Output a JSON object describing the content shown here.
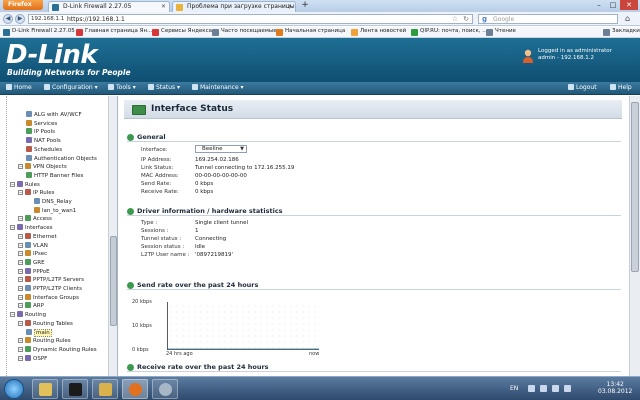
{
  "browser": {
    "app_label": "Firefox",
    "tabs": [
      {
        "title": "D-Link Firewall 2.27.05",
        "active": true
      },
      {
        "title": "Проблема при загрузке страницы",
        "active": false
      }
    ],
    "url_site": "192.168.1.1",
    "url": "https://192.168.1.1",
    "search_placeholder": "Google",
    "bookmarks": [
      "D-Link Firewall 2.27.05",
      "Главная страница Ян...",
      "Сервисы Яндекса",
      "Часто посещаемые",
      "Начальная страница",
      "Лента новостей",
      "QIP.RU: почта, поиск, ...",
      "Чтение",
      "Закладки"
    ]
  },
  "header": {
    "logo": "D-Link",
    "tagline": "Building Networks for People",
    "login_line1": "Logged in as administrator",
    "login_line2": "admin - 192.168.1.2"
  },
  "menu": {
    "home": "Home",
    "configuration": "Configuration",
    "tools": "Tools",
    "status": "Status",
    "maintenance": "Maintenance",
    "logout": "Logout",
    "help": "Help"
  },
  "tree": [
    {
      "label": "ALG with AV/WCF",
      "indent": 3
    },
    {
      "label": "Services",
      "indent": 3
    },
    {
      "label": "IP Pools",
      "indent": 3
    },
    {
      "label": "NAT Pools",
      "indent": 3
    },
    {
      "label": "Schedules",
      "indent": 3
    },
    {
      "label": "Authentication Objects",
      "indent": 3
    },
    {
      "label": "VPN Objects",
      "indent": 2
    },
    {
      "label": "HTTP Banner Files",
      "indent": 3
    },
    {
      "label": "Rules",
      "indent": 1
    },
    {
      "label": "IP Rules",
      "indent": 2
    },
    {
      "label": "DNS_Relay",
      "indent": 4
    },
    {
      "label": "lan_to_wan1",
      "indent": 4
    },
    {
      "label": "Access",
      "indent": 2
    },
    {
      "label": "Interfaces",
      "indent": 1
    },
    {
      "label": "Ethernet",
      "indent": 2
    },
    {
      "label": "VLAN",
      "indent": 2
    },
    {
      "label": "IPsec",
      "indent": 2
    },
    {
      "label": "GRE",
      "indent": 2
    },
    {
      "label": "PPPoE",
      "indent": 2
    },
    {
      "label": "PPTP/L2TP Servers",
      "indent": 2
    },
    {
      "label": "PPTP/L2TP Clients",
      "indent": 2
    },
    {
      "label": "Interface Groups",
      "indent": 2
    },
    {
      "label": "ARP",
      "indent": 2
    },
    {
      "label": "Routing",
      "indent": 1
    },
    {
      "label": "Routing Tables",
      "indent": 2
    },
    {
      "label": "main",
      "indent": 3
    },
    {
      "label": "Routing Rules",
      "indent": 2
    },
    {
      "label": "Dynamic Routing Rules",
      "indent": 2
    },
    {
      "label": "OSPF",
      "indent": 2
    }
  ],
  "page": {
    "title": "Interface Status",
    "general": {
      "heading": "General",
      "interface_label": "Interface:",
      "interface_value": "Beeline",
      "rows": [
        {
          "key": "IP Address:",
          "value": "169.254.02.186"
        },
        {
          "key": "Link Status:",
          "value": "Tunnel connecting to 172.16.255.19"
        },
        {
          "key": "MAC Address:",
          "value": "00-00-00-00-00-00"
        },
        {
          "key": "Send Rate:",
          "value": "0 kbps"
        },
        {
          "key": "Receive Rate:",
          "value": "0 kbps"
        }
      ]
    },
    "driver": {
      "heading": "Driver information / hardware statistics",
      "rows": [
        {
          "key": "Type :",
          "value": "Single client tunnel"
        },
        {
          "key": "Sessions :",
          "value": "1"
        },
        {
          "key": "Tunnel status :",
          "value": "Connecting"
        },
        {
          "key": "Session status :",
          "value": "Idle"
        },
        {
          "key": "L2TP User name :",
          "value": "'0897219819'"
        }
      ]
    },
    "send_graph": {
      "heading": "Send rate over the past 24 hours",
      "y_ticks": [
        "20 kbps",
        "10 kbps",
        "0 kbps"
      ],
      "x_ticks": [
        "24 hrs ago",
        "now"
      ]
    },
    "receive_graph": {
      "heading": "Receive rate over the past 24 hours"
    }
  },
  "taskbar": {
    "lang": "EN",
    "time": "13:42",
    "date": "03.08.2012"
  },
  "chart_data": {
    "type": "line",
    "title": "Send rate over the past 24 hours",
    "xlabel": "",
    "ylabel": "",
    "x": [
      "24 hrs ago",
      "now"
    ],
    "series": [
      {
        "values": [
          0,
          0
        ]
      }
    ],
    "ylim": [
      0,
      20
    ],
    "y_ticks": [
      "0 kbps",
      "10 kbps",
      "20 kbps"
    ],
    "grid": true
  }
}
